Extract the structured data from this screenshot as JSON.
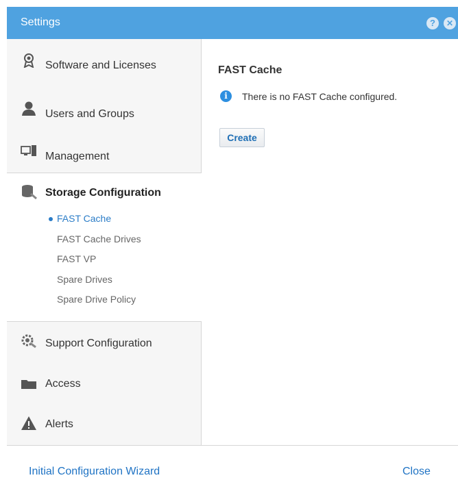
{
  "window": {
    "title": "Settings",
    "help_icon": "?",
    "close_icon": "✕"
  },
  "sidebar": {
    "items": [
      {
        "label": "Software and Licenses",
        "icon": "award-ribbon-icon"
      },
      {
        "label": "Users and Groups",
        "icon": "user-icon"
      },
      {
        "label": "Management",
        "icon": "computer-server-icon"
      }
    ],
    "active_section": {
      "label": "Storage Configuration",
      "icon": "storage-wrench-icon",
      "subitems": [
        {
          "label": "FAST Cache",
          "active": true
        },
        {
          "label": "FAST Cache Drives",
          "active": false
        },
        {
          "label": "FAST VP",
          "active": false
        },
        {
          "label": "Spare Drives",
          "active": false
        },
        {
          "label": "Spare Drive Policy",
          "active": false
        }
      ]
    },
    "lower_items": [
      {
        "label": "Support Configuration",
        "icon": "support-gear-icon"
      },
      {
        "label": "Access",
        "icon": "folder-icon"
      },
      {
        "label": "Alerts",
        "icon": "warning-icon"
      }
    ]
  },
  "content": {
    "title": "FAST Cache",
    "info_icon": "i",
    "info_text": "There is no FAST Cache configured.",
    "create_label": "Create"
  },
  "footer": {
    "wizard_label": "Initial Configuration Wizard",
    "close_label": "Close"
  },
  "colors": {
    "titlebar": "#4fa2e0",
    "link": "#1f73c4",
    "active_sub": "#2a7cc7",
    "info": "#2d8fe0"
  }
}
